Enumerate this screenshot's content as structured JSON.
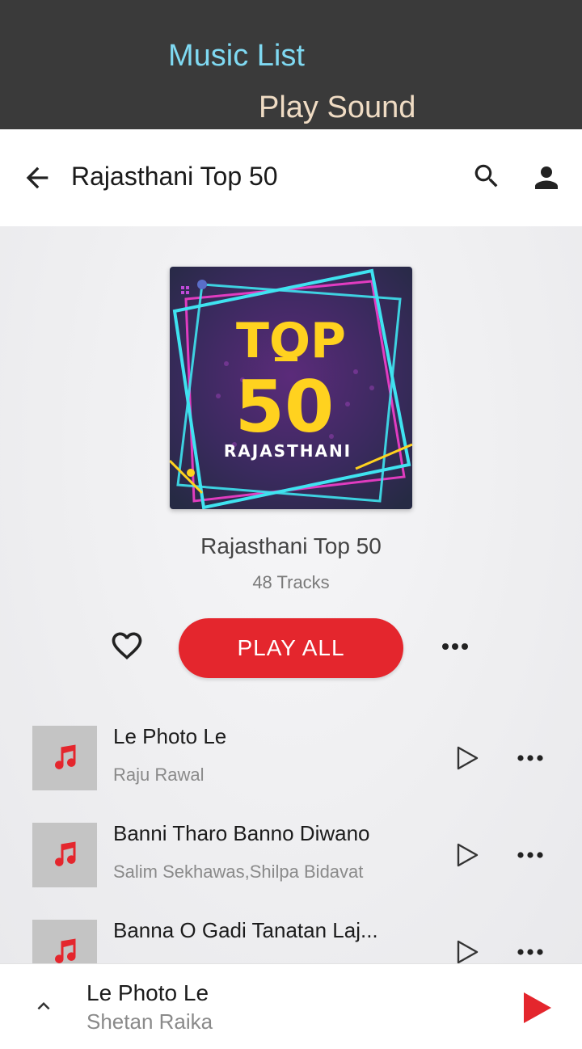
{
  "top_tabs": {
    "music_list": "Music List",
    "play_sound": "Play Sound"
  },
  "header": {
    "title": "Rajasthani Top 50",
    "icons": [
      "arrow-back-icon",
      "search-icon",
      "person-icon"
    ]
  },
  "album": {
    "cover_line1": "TOP",
    "cover_line2": "50",
    "cover_line3": "RAJASTHANI",
    "title": "Rajasthani Top 50",
    "track_count": "48 Tracks",
    "play_all_label": "PLAY ALL"
  },
  "tracks": [
    {
      "title": "Le Photo Le",
      "artist": "Raju Rawal"
    },
    {
      "title": "Banni Tharo Banno Diwano",
      "artist": "Salim Sekhawas,Shilpa Bidavat"
    },
    {
      "title": "Banna O Gadi Tanatan Laj...",
      "artist": ""
    }
  ],
  "now_playing": {
    "title": "Le Photo Le",
    "artist": "Shetan Raika"
  },
  "colors": {
    "accent": "#e4262d",
    "topbar": "#3a3a3a",
    "tab_music": "#7fd9f2",
    "tab_play": "#f0dcc4"
  }
}
